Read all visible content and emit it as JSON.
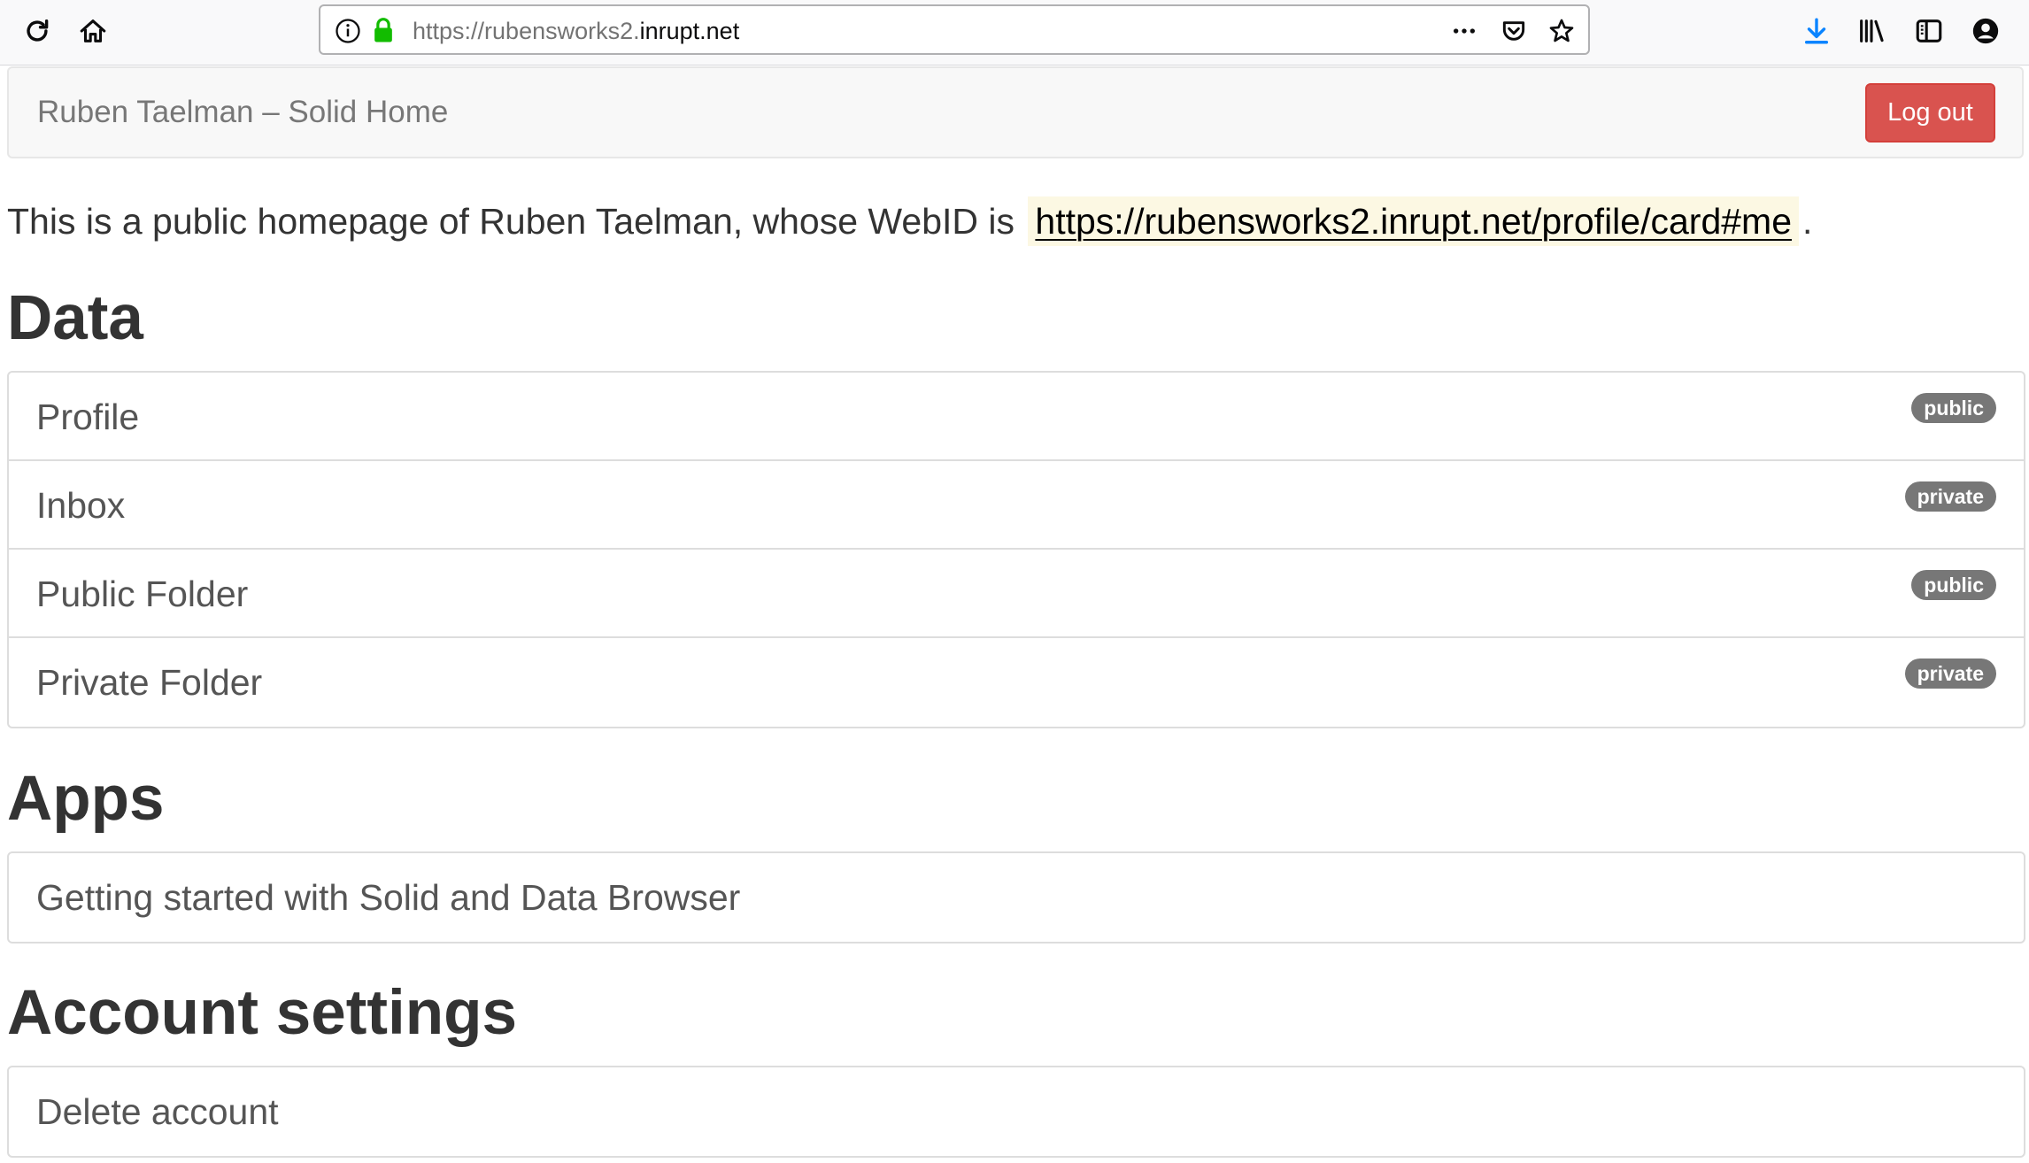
{
  "browser": {
    "url_scheme": "https://rubensworks2.",
    "url_host": "inrupt.net",
    "toolbar_icons": [
      "reload-icon",
      "home-icon",
      "info-icon",
      "lock-icon",
      "more-icon",
      "pocket-icon",
      "star-icon",
      "download-icon",
      "library-icon",
      "sidebar-icon",
      "account-icon"
    ],
    "accent_colors": {
      "lock": "#12bc00",
      "download": "#0a84ff"
    }
  },
  "navbar": {
    "brand": "Ruben Taelman – Solid Home",
    "logout_label": "Log out",
    "logout_color": "#d9534f"
  },
  "intro": {
    "text_before": "This is a public homepage of Ruben Taelman, whose WebID is",
    "webid": "https://rubensworks2.inrupt.net/profile/card#me",
    "text_after": "."
  },
  "sections": {
    "data": {
      "title": "Data",
      "items": [
        {
          "label": "Profile",
          "badge": "public"
        },
        {
          "label": "Inbox",
          "badge": "private"
        },
        {
          "label": "Public Folder",
          "badge": "public"
        },
        {
          "label": "Private Folder",
          "badge": "private"
        }
      ]
    },
    "apps": {
      "title": "Apps",
      "items": [
        {
          "label": "Getting started with Solid and Data Browser"
        }
      ]
    },
    "account": {
      "title": "Account settings",
      "items": [
        {
          "label": "Delete account"
        }
      ]
    }
  }
}
